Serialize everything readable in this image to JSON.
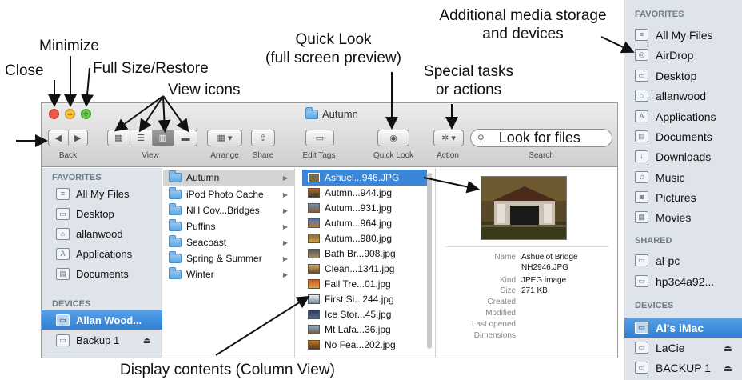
{
  "annotations": {
    "close": "Close",
    "minimize": "Minimize",
    "fullsize": "Full Size/Restore",
    "view_icons": "View icons",
    "quick_look_1": "Quick Look",
    "quick_look_2": "(full screen preview)",
    "special_1": "Special tasks",
    "special_2": "or actions",
    "media_1": "Additional media storage",
    "media_2": "and devices",
    "column_view": "Display contents (Column View)"
  },
  "window": {
    "title": "Autumn",
    "toolbar_labels": {
      "back": "Back",
      "view": "View",
      "arrange": "Arrange",
      "share": "Share",
      "edit_tags": "Edit Tags",
      "quick_look": "Quick Look",
      "action": "Action",
      "search": "Search"
    },
    "search_text": "Look for files"
  },
  "sidebar": {
    "favorites_header": "FAVORITES",
    "favorites": [
      "All My Files",
      "Desktop",
      "allanwood",
      "Applications",
      "Documents"
    ],
    "devices_header": "DEVICES",
    "devices": [
      "Allan Wood...",
      "Backup 1"
    ]
  },
  "column1": [
    "Autumn",
    "iPod Photo Cache",
    "NH Cov...Bridges",
    "Puffins",
    "Seacoast",
    "Spring & Summer",
    "Winter"
  ],
  "column2": [
    "Ashuel...946.JPG",
    "Autmn...944.jpg",
    "Autum...931.jpg",
    "Autum...964.jpg",
    "Autum...980.jpg",
    "Bath Br...908.jpg",
    "Clean...1341.jpg",
    "Fall Tre...01.jpg",
    "First Si...244.jpg",
    "Ice Stor...45.jpg",
    "Mt Lafa...36.jpg",
    "No Fea...202.jpg"
  ],
  "preview": {
    "name_label": "Name",
    "name_value_1": "Ashuelot Bridge",
    "name_value_2": "NH2946.JPG",
    "kind_label": "Kind",
    "kind_value": "JPEG image",
    "size_label": "Size",
    "size_value": "271 KB",
    "created_label": "Created",
    "modified_label": "Modified",
    "last_opened_label": "Last opened",
    "dimensions_label": "Dimensions"
  },
  "right_panel": {
    "favorites_header": "FAVORITES",
    "favorites": [
      "All My Files",
      "AirDrop",
      "Desktop",
      "allanwood",
      "Applications",
      "Documents",
      "Downloads",
      "Music",
      "Pictures",
      "Movies"
    ],
    "shared_header": "SHARED",
    "shared": [
      "al-pc",
      "hp3c4a92..."
    ],
    "devices_header": "DEVICES",
    "devices": [
      "Al's iMac",
      "LaCie",
      "BACKUP 1"
    ]
  }
}
